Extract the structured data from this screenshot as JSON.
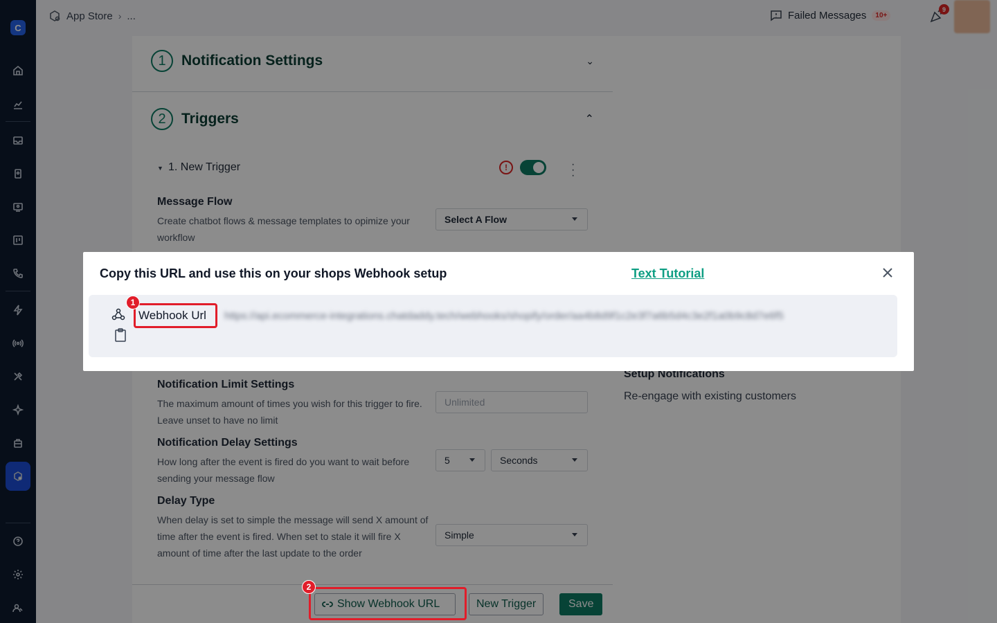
{
  "header": {
    "breadcrumb_root": "App Store",
    "breadcrumb_more": "...",
    "failed_messages": "Failed Messages",
    "failed_count": "10+",
    "notifications_count": "9"
  },
  "sidebar": {
    "logo": "C",
    "icons": [
      "home-icon",
      "analytics-icon",
      "inbox-icon",
      "contacts-icon",
      "broadcast-icon",
      "kanban-icon",
      "phone-icon",
      "flash-icon",
      "signal-icon",
      "tools-icon",
      "sparkle-icon",
      "bag-icon",
      "app-store-icon",
      "help-icon",
      "settings-icon",
      "team-icon"
    ]
  },
  "sections": {
    "notification_settings": {
      "number": "1",
      "title": "Notification Settings"
    },
    "triggers": {
      "number": "2",
      "title": "Triggers"
    }
  },
  "trigger": {
    "name": "1. New Trigger",
    "enabled": true
  },
  "settings": {
    "message_flow": {
      "title": "Message Flow",
      "desc": "Create chatbot flows & message templates to opimize your workflow",
      "value": "Select A Flow"
    },
    "limit": {
      "title": "Notification Limit Settings",
      "desc": "The maximum amount of times you wish for this trigger to fire. Leave unset to have no limit",
      "placeholder": "Unlimited"
    },
    "delay": {
      "title": "Notification Delay Settings",
      "desc": "How long after the event is fired do you want to wait before sending your message flow",
      "amount": "5",
      "unit": "Seconds"
    },
    "delay_type": {
      "title": "Delay Type",
      "desc": "When delay is set to simple the message will send X amount of time after the event is fired. When set to stale it will fire X amount of time after the last update to the order",
      "value": "Simple"
    }
  },
  "right_info": {
    "title": "Setup Notifications",
    "subtitle": "Re-engage with existing customers"
  },
  "footer": {
    "show_webhook": "Show Webhook URL",
    "new_trigger": "New Trigger",
    "save": "Save"
  },
  "modal": {
    "title": "Copy this URL and use this on your shops Webhook setup",
    "tutorial_link": "Text Tutorial",
    "webhook_label": "Webhook Url",
    "webhook_url": "https://api.ecommerce-integrations.chatdaddy.tech/webhooks/shopify/order/aa4b8d9f1c2e3f7a6b5d4c3e2f1a0b9c8d7e6f5"
  },
  "annotations": [
    "1",
    "2"
  ],
  "colors": {
    "accent": "#0e7a63",
    "link": "#0e9e83",
    "highlight": "#e11d2a",
    "sidebar": "#0d1b2e"
  }
}
